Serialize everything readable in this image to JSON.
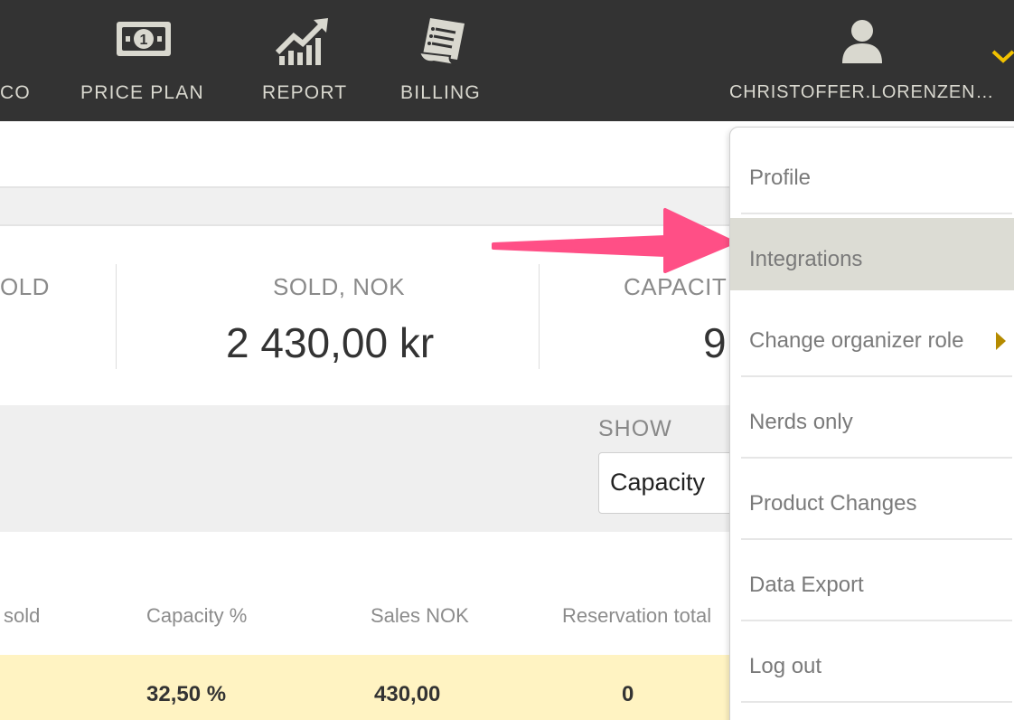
{
  "nav": {
    "items": [
      {
        "label": "CO",
        "icon": "partial-icon"
      },
      {
        "label": "PRICE  PLAN",
        "icon": "money-icon"
      },
      {
        "label": "REPORT",
        "icon": "chart-up-icon"
      },
      {
        "label": "BILLING",
        "icon": "receipt-icon"
      }
    ],
    "user": {
      "label": "CHRISTOFFER.LORENZEN…",
      "icon": "user-icon"
    },
    "menu_toggle_icon": "chevron-down-icon",
    "accent": "#f2c200"
  },
  "stats": {
    "sold_partial_label": "OLD",
    "sold_nok": {
      "label": "SOLD, NOK",
      "value": "2 430,00 kr"
    },
    "capacity": {
      "label": "CAPACIT",
      "value": "9"
    }
  },
  "filter": {
    "show_label": "SHOW",
    "selected": "Capacity"
  },
  "table": {
    "headers": [
      "sold",
      "Capacity %",
      "Sales NOK",
      "Reservation total"
    ],
    "rows": [
      {
        "capacity_pct": "32,50 %",
        "sales_nok": "430,00",
        "reservation_total": "0"
      }
    ],
    "highlight_color": "#fff3c2"
  },
  "dropdown": {
    "items": [
      {
        "label": "Profile"
      },
      {
        "label": "Integrations",
        "active": true
      },
      {
        "label": "Change organizer role",
        "has_submenu": true
      },
      {
        "label": "Nerds only"
      },
      {
        "label": "Product Changes"
      },
      {
        "label": "Data Export"
      },
      {
        "label": "Log out"
      }
    ],
    "active_color": "#dcdcd4"
  },
  "annotation": {
    "arrow_color": "#ff4f86"
  }
}
